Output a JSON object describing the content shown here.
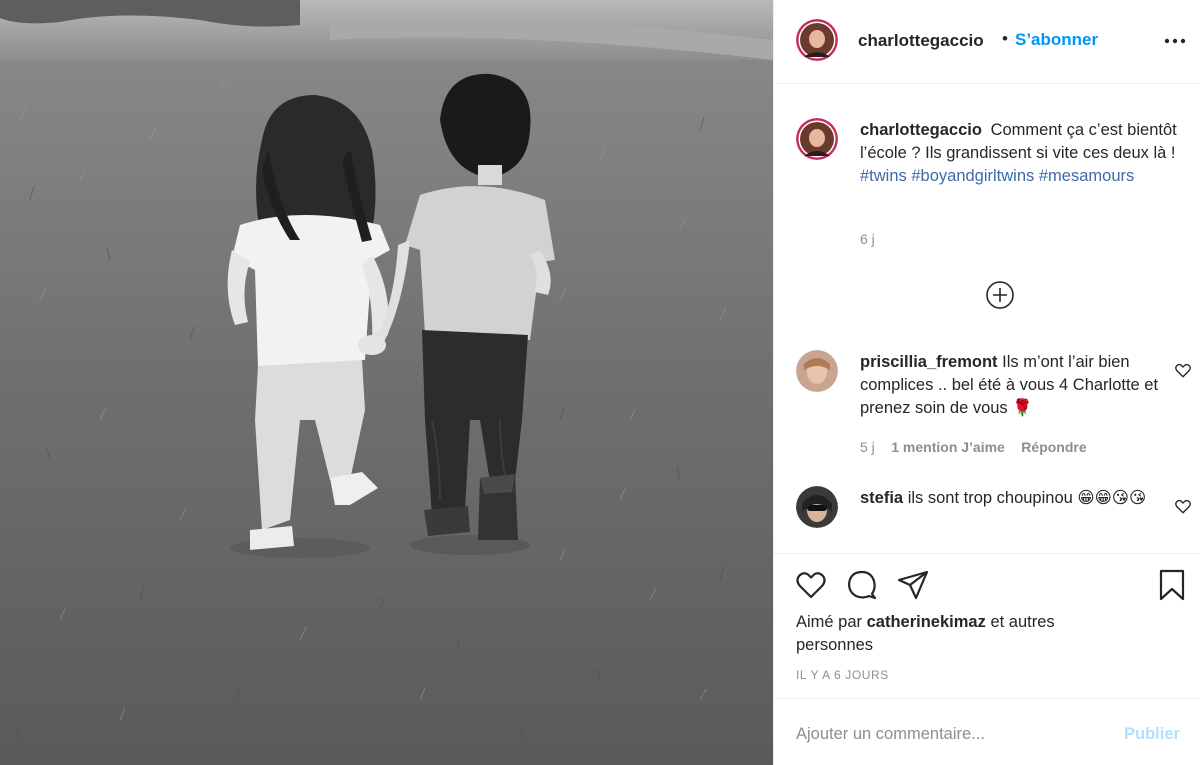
{
  "post": {
    "author": "charlottegaccio",
    "follow_label": "S’abonner",
    "separator": "•",
    "more_icon": "more-horizontal-icon"
  },
  "caption": {
    "username": "charlottegaccio",
    "text": "Comment ça c’est bientôt l’école ? Ils grandissent si vite ces deux là ! ",
    "hashtags": [
      "#twins",
      "#boyandgirltwins",
      "#mesamours"
    ],
    "time": "6 j"
  },
  "comments": [
    {
      "username": "priscillia_fremont",
      "text": "Ils m’ont l’air bien complices .. bel été à vous 4 Charlotte et prenez soin de vous 🌹",
      "time": "5 j",
      "likes": "1 mention J’aime",
      "reply": "Répondre"
    },
    {
      "username": "stefia",
      "text": "ils sont trop choupinou 😁😁😘😘"
    }
  ],
  "actions": {
    "like_icon": "heart-icon",
    "comment_icon": "comment-icon",
    "share_icon": "paper-plane-icon",
    "save_icon": "bookmark-icon"
  },
  "likes": {
    "prefix": "Aimé par",
    "user": "catherinekimaz",
    "suffix": "et autres personnes"
  },
  "date": "IL Y A 6 JOURS",
  "add_comment": {
    "placeholder": "Ajouter un commentaire...",
    "publish": "Publier"
  },
  "colors": {
    "link_blue": "#0095f6",
    "hashtag": "#3d6aa8",
    "muted": "#8e8e8e",
    "publish_disabled": "#b2dffc"
  }
}
